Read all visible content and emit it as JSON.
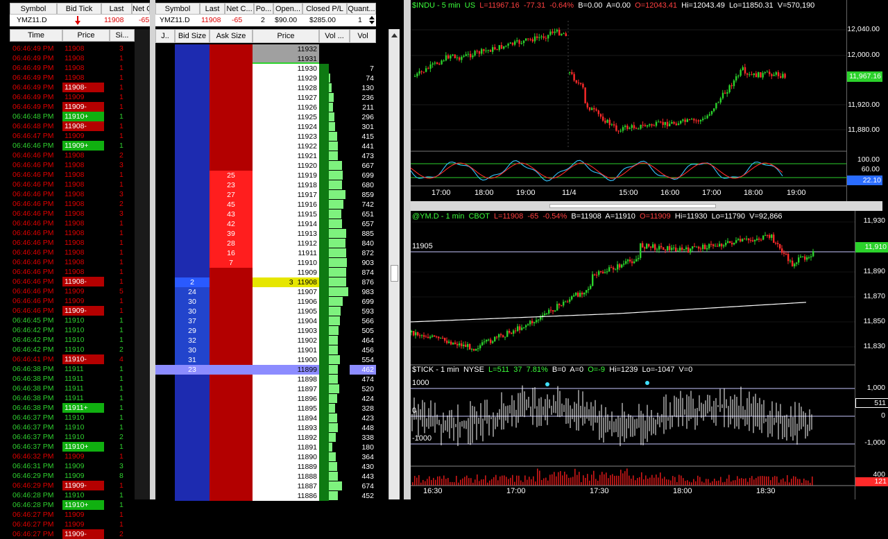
{
  "quote_bar_left": {
    "headers": [
      "Symbol",
      "Bid Tick",
      "Last",
      "Net C"
    ],
    "symbol": "YMZ11.D",
    "last": "11908",
    "net_change": "-65"
  },
  "time_sales": {
    "headers": [
      "Time",
      "Price",
      "Si..."
    ],
    "rows": [
      {
        "time": "06:46:49 PM",
        "price": "11908",
        "size": "3",
        "c": "red",
        "hl": ""
      },
      {
        "time": "06:46:49 PM",
        "price": "11908",
        "size": "1",
        "c": "red",
        "hl": ""
      },
      {
        "time": "06:46:49 PM",
        "price": "11908",
        "size": "1",
        "c": "red",
        "hl": ""
      },
      {
        "time": "06:46:49 PM",
        "price": "11908",
        "size": "1",
        "c": "red",
        "hl": ""
      },
      {
        "time": "06:46:49 PM",
        "price": "11908-",
        "size": "1",
        "c": "red",
        "hl": "red"
      },
      {
        "time": "06:46:49 PM",
        "price": "11909",
        "size": "1",
        "c": "red",
        "hl": ""
      },
      {
        "time": "06:46:49 PM",
        "price": "11909-",
        "size": "1",
        "c": "red",
        "hl": "red"
      },
      {
        "time": "06:46:48 PM",
        "price": "11910+",
        "size": "1",
        "c": "green",
        "hl": "green"
      },
      {
        "time": "06:46:48 PM",
        "price": "11908-",
        "size": "1",
        "c": "red",
        "hl": "red"
      },
      {
        "time": "06:46:47 PM",
        "price": "11909",
        "size": "1",
        "c": "red",
        "hl": ""
      },
      {
        "time": "06:46:46 PM",
        "price": "11909+",
        "size": "1",
        "c": "green",
        "hl": "green"
      },
      {
        "time": "06:46:46 PM",
        "price": "11908",
        "size": "2",
        "c": "red",
        "hl": ""
      },
      {
        "time": "06:46:46 PM",
        "price": "11908",
        "size": "3",
        "c": "red",
        "hl": ""
      },
      {
        "time": "06:46:46 PM",
        "price": "11908",
        "size": "1",
        "c": "red",
        "hl": ""
      },
      {
        "time": "06:46:46 PM",
        "price": "11908",
        "size": "1",
        "c": "red",
        "hl": ""
      },
      {
        "time": "06:46:46 PM",
        "price": "11908",
        "size": "3",
        "c": "red",
        "hl": ""
      },
      {
        "time": "06:46:46 PM",
        "price": "11908",
        "size": "2",
        "c": "red",
        "hl": ""
      },
      {
        "time": "06:46:46 PM",
        "price": "11908",
        "size": "3",
        "c": "red",
        "hl": ""
      },
      {
        "time": "06:46:46 PM",
        "price": "11908",
        "size": "1",
        "c": "red",
        "hl": ""
      },
      {
        "time": "06:46:46 PM",
        "price": "11908",
        "size": "1",
        "c": "red",
        "hl": ""
      },
      {
        "time": "06:46:46 PM",
        "price": "11908",
        "size": "1",
        "c": "red",
        "hl": ""
      },
      {
        "time": "06:46:46 PM",
        "price": "11908",
        "size": "1",
        "c": "red",
        "hl": ""
      },
      {
        "time": "06:46:46 PM",
        "price": "11908",
        "size": "1",
        "c": "red",
        "hl": ""
      },
      {
        "time": "06:46:46 PM",
        "price": "11908",
        "size": "1",
        "c": "red",
        "hl": ""
      },
      {
        "time": "06:46:46 PM",
        "price": "11908-",
        "size": "1",
        "c": "red",
        "hl": "red"
      },
      {
        "time": "06:46:46 PM",
        "price": "11909",
        "size": "5",
        "c": "red",
        "hl": ""
      },
      {
        "time": "06:46:46 PM",
        "price": "11909",
        "size": "1",
        "c": "red",
        "hl": ""
      },
      {
        "time": "06:46:46 PM",
        "price": "11909-",
        "size": "1",
        "c": "red",
        "hl": "red"
      },
      {
        "time": "06:46:45 PM",
        "price": "11910",
        "size": "1",
        "c": "green",
        "hl": ""
      },
      {
        "time": "06:46:42 PM",
        "price": "11910",
        "size": "1",
        "c": "green",
        "hl": ""
      },
      {
        "time": "06:46:42 PM",
        "price": "11910",
        "size": "1",
        "c": "green",
        "hl": ""
      },
      {
        "time": "06:46:42 PM",
        "price": "11910",
        "size": "2",
        "c": "green",
        "hl": ""
      },
      {
        "time": "06:46:41 PM",
        "price": "11910-",
        "size": "4",
        "c": "red",
        "hl": "red"
      },
      {
        "time": "06:46:38 PM",
        "price": "11911",
        "size": "1",
        "c": "green",
        "hl": ""
      },
      {
        "time": "06:46:38 PM",
        "price": "11911",
        "size": "1",
        "c": "green",
        "hl": ""
      },
      {
        "time": "06:46:38 PM",
        "price": "11911",
        "size": "1",
        "c": "green",
        "hl": ""
      },
      {
        "time": "06:46:38 PM",
        "price": "11911",
        "size": "1",
        "c": "green",
        "hl": ""
      },
      {
        "time": "06:46:38 PM",
        "price": "11911+",
        "size": "1",
        "c": "green",
        "hl": "green"
      },
      {
        "time": "06:46:37 PM",
        "price": "11910",
        "size": "1",
        "c": "green",
        "hl": ""
      },
      {
        "time": "06:46:37 PM",
        "price": "11910",
        "size": "1",
        "c": "green",
        "hl": ""
      },
      {
        "time": "06:46:37 PM",
        "price": "11910",
        "size": "2",
        "c": "green",
        "hl": ""
      },
      {
        "time": "06:46:37 PM",
        "price": "11910+",
        "size": "1",
        "c": "green",
        "hl": "green"
      },
      {
        "time": "06:46:32 PM",
        "price": "11909",
        "size": "1",
        "c": "red",
        "hl": ""
      },
      {
        "time": "06:46:31 PM",
        "price": "11909",
        "size": "3",
        "c": "green",
        "hl": ""
      },
      {
        "time": "06:46:29 PM",
        "price": "11909",
        "size": "8",
        "c": "green",
        "hl": ""
      },
      {
        "time": "06:46:29 PM",
        "price": "11909-",
        "size": "1",
        "c": "red",
        "hl": "red"
      },
      {
        "time": "06:46:28 PM",
        "price": "11910",
        "size": "1",
        "c": "green",
        "hl": ""
      },
      {
        "time": "06:46:28 PM",
        "price": "11910+",
        "size": "1",
        "c": "green",
        "hl": "green"
      },
      {
        "time": "06:46:27 PM",
        "price": "11909",
        "size": "1",
        "c": "red",
        "hl": ""
      },
      {
        "time": "06:46:27 PM",
        "price": "11909",
        "size": "1",
        "c": "red",
        "hl": ""
      },
      {
        "time": "06:46:27 PM",
        "price": "11909-",
        "size": "2",
        "c": "red",
        "hl": "red"
      }
    ]
  },
  "position_bar": {
    "headers": [
      "Symbol",
      "Last",
      "Net C...",
      "Po...",
      "Open...",
      "Closed P/L",
      "Quant..."
    ],
    "symbol": "YMZ11.D",
    "last": "11908",
    "net_change": "-65",
    "position": "2",
    "open_pl": "$90.00",
    "closed_pl": "$285.00",
    "quantity": "1"
  },
  "ladder": {
    "headers": [
      "J..",
      "Bid Size",
      "Ask Size",
      "Price",
      "Vol ...",
      "Vol"
    ],
    "rows": [
      {
        "price": "11932",
        "bid": "",
        "ask": "",
        "vol": "",
        "vp": 0
      },
      {
        "price": "11931",
        "bid": "",
        "ask": "",
        "vol": "",
        "vp": 0
      },
      {
        "price": "11930",
        "bid": "",
        "ask": "",
        "vol": "7",
        "vp": 0.01
      },
      {
        "price": "11929",
        "bid": "",
        "ask": "",
        "vol": "74",
        "vp": 0.08
      },
      {
        "price": "11928",
        "bid": "",
        "ask": "",
        "vol": "130",
        "vp": 0.13
      },
      {
        "price": "11927",
        "bid": "",
        "ask": "",
        "vol": "236",
        "vp": 0.24
      },
      {
        "price": "11926",
        "bid": "",
        "ask": "",
        "vol": "211",
        "vp": 0.21
      },
      {
        "price": "11925",
        "bid": "",
        "ask": "",
        "vol": "296",
        "vp": 0.3
      },
      {
        "price": "11924",
        "bid": "",
        "ask": "",
        "vol": "301",
        "vp": 0.31
      },
      {
        "price": "11923",
        "bid": "",
        "ask": "",
        "vol": "415",
        "vp": 0.42
      },
      {
        "price": "11922",
        "bid": "",
        "ask": "",
        "vol": "441",
        "vp": 0.45
      },
      {
        "price": "11921",
        "bid": "",
        "ask": "",
        "vol": "473",
        "vp": 0.48
      },
      {
        "price": "11920",
        "bid": "",
        "ask": "",
        "vol": "667",
        "vp": 0.68
      },
      {
        "price": "11919",
        "bid": "",
        "ask": "25",
        "vol": "699",
        "vp": 0.71
      },
      {
        "price": "11918",
        "bid": "",
        "ask": "23",
        "vol": "680",
        "vp": 0.69
      },
      {
        "price": "11917",
        "bid": "",
        "ask": "27",
        "vol": "859",
        "vp": 0.87
      },
      {
        "price": "11916",
        "bid": "",
        "ask": "45",
        "vol": "742",
        "vp": 0.75
      },
      {
        "price": "11915",
        "bid": "",
        "ask": "43",
        "vol": "651",
        "vp": 0.66
      },
      {
        "price": "11914",
        "bid": "",
        "ask": "42",
        "vol": "657",
        "vp": 0.67
      },
      {
        "price": "11913",
        "bid": "",
        "ask": "39",
        "vol": "885",
        "vp": 0.9
      },
      {
        "price": "11912",
        "bid": "",
        "ask": "28",
        "vol": "840",
        "vp": 0.85
      },
      {
        "price": "11911",
        "bid": "",
        "ask": "16",
        "vol": "872",
        "vp": 0.89
      },
      {
        "price": "11910",
        "bid": "",
        "ask": "7",
        "vol": "903",
        "vp": 0.92
      },
      {
        "price": "11909",
        "bid": "",
        "ask": "",
        "vol": "874",
        "vp": 0.89
      },
      {
        "price": "11908",
        "bid": "2",
        "ask": "3",
        "vol": "876",
        "vp": 0.89
      },
      {
        "price": "11907",
        "bid": "24",
        "ask": "",
        "vol": "983",
        "vp": 1.0
      },
      {
        "price": "11906",
        "bid": "30",
        "ask": "",
        "vol": "699",
        "vp": 0.71
      },
      {
        "price": "11905",
        "bid": "30",
        "ask": "",
        "vol": "593",
        "vp": 0.6
      },
      {
        "price": "11904",
        "bid": "37",
        "ask": "",
        "vol": "566",
        "vp": 0.58
      },
      {
        "price": "11903",
        "bid": "29",
        "ask": "",
        "vol": "505",
        "vp": 0.51
      },
      {
        "price": "11902",
        "bid": "32",
        "ask": "",
        "vol": "464",
        "vp": 0.47
      },
      {
        "price": "11901",
        "bid": "30",
        "ask": "",
        "vol": "456",
        "vp": 0.46
      },
      {
        "price": "11900",
        "bid": "31",
        "ask": "",
        "vol": "554",
        "vp": 0.56
      },
      {
        "price": "11899",
        "bid": "23",
        "ask": "",
        "vol": "462",
        "vp": 0.47
      },
      {
        "price": "11898",
        "bid": "",
        "ask": "",
        "vol": "474",
        "vp": 0.48
      },
      {
        "price": "11897",
        "bid": "",
        "ask": "",
        "vol": "520",
        "vp": 0.53
      },
      {
        "price": "11896",
        "bid": "",
        "ask": "",
        "vol": "424",
        "vp": 0.43
      },
      {
        "price": "11895",
        "bid": "",
        "ask": "",
        "vol": "328",
        "vp": 0.33
      },
      {
        "price": "11894",
        "bid": "",
        "ask": "",
        "vol": "423",
        "vp": 0.43
      },
      {
        "price": "11893",
        "bid": "",
        "ask": "",
        "vol": "448",
        "vp": 0.46
      },
      {
        "price": "11892",
        "bid": "",
        "ask": "",
        "vol": "338",
        "vp": 0.34
      },
      {
        "price": "11891",
        "bid": "",
        "ask": "",
        "vol": "180",
        "vp": 0.18
      },
      {
        "price": "11890",
        "bid": "",
        "ask": "",
        "vol": "364",
        "vp": 0.37
      },
      {
        "price": "11889",
        "bid": "",
        "ask": "",
        "vol": "430",
        "vp": 0.44
      },
      {
        "price": "11888",
        "bid": "",
        "ask": "",
        "vol": "443",
        "vp": 0.45
      },
      {
        "price": "11887",
        "bid": "",
        "ask": "",
        "vol": "674",
        "vp": 0.69
      },
      {
        "price": "11886",
        "bid": "",
        "ask": "",
        "vol": "452",
        "vp": 0.46
      }
    ]
  },
  "chart_indu": {
    "title_parts": [
      {
        "t": "$INDU - 5 min  US  ",
        "c": "#3cff3c"
      },
      {
        "t": "L=11967.16  -77.31  -0.64%  ",
        "c": "#ff4040"
      },
      {
        "t": "B=0.00  A=0.00  ",
        "c": "#ffffff"
      },
      {
        "t": "O=12043.41  ",
        "c": "#ff4040"
      },
      {
        "t": "Hi=12043.49  Lo=11850.31  V=570,190",
        "c": "#ffffff"
      }
    ],
    "y_labels": [
      "12,040.00",
      "12,000.00",
      "11,960.00",
      "11,920.00",
      "11,880.00"
    ],
    "last_tag": "11,967.16",
    "osc_labels": [
      "100.00",
      "60.00"
    ],
    "osc_tag": "22.10",
    "x_labels": [
      "17:00",
      "18:00",
      "19:00",
      "11/4",
      "15:00",
      "16:00",
      "17:00",
      "18:00",
      "19:00"
    ]
  },
  "chart_ym": {
    "title_parts": [
      {
        "t": "@YM.D - 1 min  CBOT  ",
        "c": "#3cff3c"
      },
      {
        "t": "L=11908  -65  -0.54%  ",
        "c": "#ff4040"
      },
      {
        "t": "B=11908  A=11910  ",
        "c": "#ffffff"
      },
      {
        "t": "O=11909  ",
        "c": "#ff4040"
      },
      {
        "t": "Hi=11930  Lo=11790  V=92,866",
        "c": "#ffffff"
      }
    ],
    "ref_label": "11905",
    "y_labels": [
      "11,930",
      "11,910",
      "11,890",
      "11,870",
      "11,850",
      "11,830"
    ],
    "last_tag": "11,910"
  },
  "chart_tick": {
    "title_parts": [
      {
        "t": "$TICK - 1 min  NYSE  ",
        "c": "#ffffff"
      },
      {
        "t": "L=511  37  7.81%  ",
        "c": "#3cff3c"
      },
      {
        "t": "B=0  A=0  ",
        "c": "#ffffff"
      },
      {
        "t": "O=-9  ",
        "c": "#3cff3c"
      },
      {
        "t": "Hi=1239  Lo=-1047  V=0",
        "c": "#ffffff"
      }
    ],
    "left_labels": [
      "1000",
      "0",
      "-1000"
    ],
    "y_labels": [
      "1,000",
      "0",
      "-1,000"
    ],
    "last_tag": "511",
    "vol_label": "400",
    "vol_tag": "121",
    "x_labels": [
      "16:30",
      "17:00",
      "17:30",
      "18:00",
      "18:30"
    ]
  },
  "colors": {
    "up": "#2bd22b",
    "down": "#ff2a2a",
    "bid": "#1d2bb0",
    "ask": "#b30000",
    "ask_hi": "#ff1e1e",
    "last": "#e6e600",
    "sel": "#8c8cff"
  }
}
